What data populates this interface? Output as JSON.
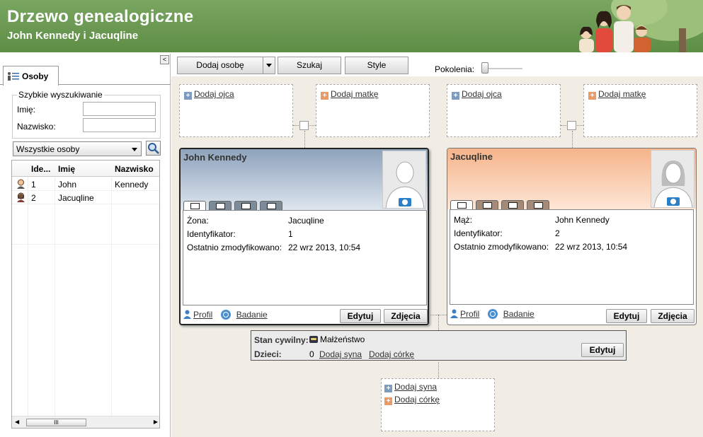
{
  "header": {
    "title": "Drzewo genealogiczne",
    "subtitle": "John Kennedy i Jacuqline"
  },
  "left_panel": {
    "collapse_label": "<",
    "tab_label": "Osoby",
    "quick_search": {
      "legend": "Szybkie wyszukiwanie",
      "first_name_label": "Imię:",
      "first_name_value": "",
      "last_name_label": "Nazwisko:",
      "last_name_value": ""
    },
    "filter": {
      "selected": "Wszystkie osoby"
    },
    "grid": {
      "columns": [
        "Ide...",
        "Imię",
        "Nazwisko"
      ],
      "rows": [
        {
          "id": "1",
          "first": "John",
          "last": "Kennedy",
          "gender": "male"
        },
        {
          "id": "2",
          "first": "Jacuqline",
          "last": "",
          "gender": "female"
        }
      ],
      "scroll_thumb": "III",
      "scroll_left": "◀",
      "scroll_right": "▶"
    }
  },
  "toolbar": {
    "add_person": "Dodaj osobę",
    "search": "Szukaj",
    "styles": "Style",
    "generations_label": "Pokolenia:",
    "generations_level": 0
  },
  "tree": {
    "add_father": "Dodaj ojca",
    "add_mother": "Dodaj matkę",
    "person1": {
      "name": "John Kennedy",
      "fields": [
        {
          "k": "Żona:",
          "v": "Jacuqline"
        },
        {
          "k": "Identyfikator:",
          "v": "1"
        },
        {
          "k": "Ostatnio zmodyfikowano:",
          "v": "22 wrz 2013, 10:54"
        }
      ],
      "profile": "Profil",
      "research": "Badanie",
      "edit": "Edytuj",
      "photos": "Zdjęcia"
    },
    "person2": {
      "name": "Jacuqline",
      "fields": [
        {
          "k": "Mąż:",
          "v": "John Kennedy"
        },
        {
          "k": "Identyfikator:",
          "v": "2"
        },
        {
          "k": "Ostatnio zmodyfikowano:",
          "v": "22 wrz 2013, 10:54"
        }
      ],
      "profile": "Profil",
      "research": "Badanie",
      "edit": "Edytuj",
      "photos": "Zdjęcia"
    },
    "marriage": {
      "status_label": "Stan cywilny:",
      "status_value": "Małżeństwo",
      "children_label": "Dzieci:",
      "children_count": "0",
      "add_son": "Dodaj syna",
      "add_daughter": "Dodaj córkę",
      "edit": "Edytuj"
    },
    "children_box": {
      "add_son": "Dodaj syna",
      "add_daughter": "Dodaj córkę"
    }
  },
  "colors": {
    "header_green": "#6a9a52",
    "male_card": "#b5c6da",
    "female_card": "#f8c7a6",
    "background": "#f1ede4"
  }
}
